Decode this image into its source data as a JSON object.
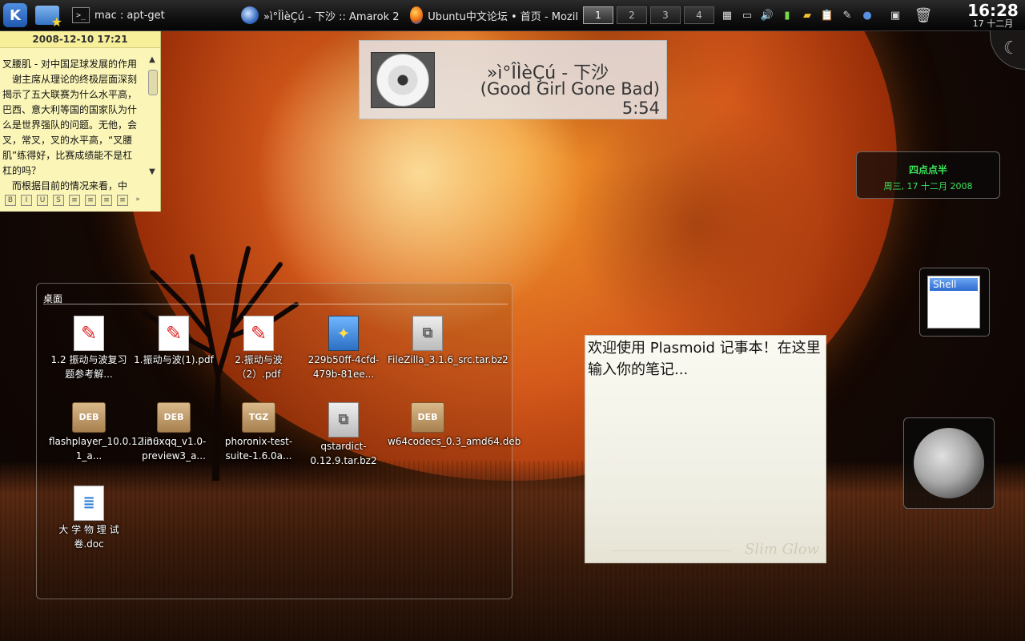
{
  "taskbar": {
    "kmenu_label": "K",
    "tasks": [
      {
        "icon": "terminal-icon",
        "title": "mac : apt-get"
      },
      {
        "icon": "amarok-icon",
        "title": "»ì°ÎÌèÇú - 下沙  ::  Amarok 2"
      },
      {
        "icon": "firefox-icon",
        "title": "Ubuntu中文论坛 • 首页 - Mozil"
      }
    ],
    "pager": [
      "1",
      "2",
      "3",
      "4"
    ],
    "pager_active": "1",
    "clock_time": "16:28",
    "clock_date": "17 十二月"
  },
  "note_widget": {
    "title": "2008-12-10 17:21",
    "text": "叉腰肌 - 对中国足球发展的作用\n　谢主席从理论的终极层面深刻揭示了五大联赛为什么水平高，巴西、意大利等国的国家队为什么是世界强队的问题。无他，会叉，常叉，叉的水平高，“叉腰肌”练得好，比赛成绩能不是杠杠的吗？\n　而根据目前的情况来看，中"
  },
  "now_playing": {
    "title": "»ì°ÎÌèÇú - 下沙",
    "album_time": "(Good Girl Gone Bad) 5:54"
  },
  "clock_widget": {
    "fuzzy": "四点点半",
    "date": "周三, 17 十二月 2008"
  },
  "folder_view": {
    "title": "桌面",
    "items": [
      {
        "label": "1.2 振动与波复习题参考解...",
        "type": "pdf"
      },
      {
        "label": "1.振动与波(1).pdf",
        "type": "pdf"
      },
      {
        "label": "2.振动与波（2）.pdf",
        "type": "pdf"
      },
      {
        "label": "229b50ff-4cfd-479b-81ee...",
        "type": "image"
      },
      {
        "label": "FileZilla_3.1.6_src.tar.bz2",
        "type": "archive"
      },
      {
        "label": "flashplayer_10.0.12.36-1_a...",
        "type": "deb"
      },
      {
        "label": "linuxqq_v1.0-preview3_a...",
        "type": "deb"
      },
      {
        "label": "phoronix-test-suite-1.6.0a...",
        "type": "tgz"
      },
      {
        "label": "qstardict-0.12.9.tar.bz2",
        "type": "archive"
      },
      {
        "label": "w64codecs_0.3_amd64.deb",
        "type": "deb"
      },
      {
        "label": "大 学 物 理 试卷.doc",
        "type": "doc"
      }
    ],
    "badge_deb": "DEB",
    "badge_tgz": "TGZ"
  },
  "plasma_note": {
    "text": "欢迎使用 Plasmoid 记事本！在这里输入你的笔记...",
    "theme_label": "Slim Glow"
  },
  "shell_widget": {
    "label": "Shell"
  }
}
